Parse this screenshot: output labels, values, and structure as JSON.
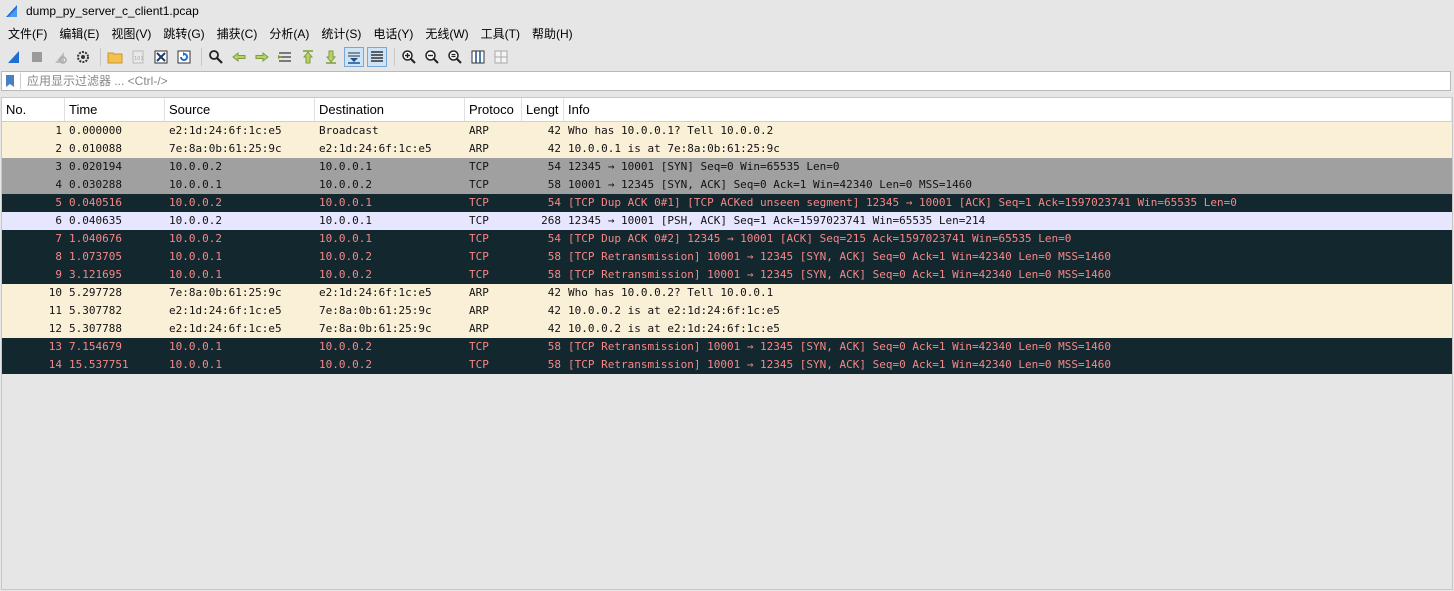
{
  "window": {
    "title": "dump_py_server_c_client1.pcap"
  },
  "menu": [
    "文件(F)",
    "编辑(E)",
    "视图(V)",
    "跳转(G)",
    "捕获(C)",
    "分析(A)",
    "统计(S)",
    "电话(Y)",
    "无线(W)",
    "工具(T)",
    "帮助(H)"
  ],
  "filter": {
    "placeholder": "应用显示过滤器 ... <Ctrl-/>",
    "value": ""
  },
  "columns": {
    "no": "No.",
    "time": "Time",
    "source": "Source",
    "destination": "Destination",
    "protocol": "Protoco",
    "length": "Lengt",
    "info": "Info"
  },
  "colors": {
    "arp_bg": "#faf0d7",
    "tcp_gray_bg": "#a0a0a0",
    "tcp_bad_bg": "#12272e",
    "tcp_bad_fg": "#f78787",
    "tcp_ok_bg": "#e7e6ff",
    "selected_toolbar": "#cde3f7"
  },
  "packets": [
    {
      "no": "1",
      "time": "0.000000",
      "source": "e2:1d:24:6f:1c:e5",
      "destination": "Broadcast",
      "protocol": "ARP",
      "length": "42",
      "info": "Who has 10.0.0.1? Tell 10.0.0.2",
      "style": "arp"
    },
    {
      "no": "2",
      "time": "0.010088",
      "source": "7e:8a:0b:61:25:9c",
      "destination": "e2:1d:24:6f:1c:e5",
      "protocol": "ARP",
      "length": "42",
      "info": "10.0.0.1 is at 7e:8a:0b:61:25:9c",
      "style": "arp"
    },
    {
      "no": "3",
      "time": "0.020194",
      "source": "10.0.0.2",
      "destination": "10.0.0.1",
      "protocol": "TCP",
      "length": "54",
      "info": "12345 → 10001 [SYN] Seq=0 Win=65535 Len=0",
      "style": "tcp-gray"
    },
    {
      "no": "4",
      "time": "0.030288",
      "source": "10.0.0.1",
      "destination": "10.0.0.2",
      "protocol": "TCP",
      "length": "58",
      "info": "10001 → 12345 [SYN, ACK] Seq=0 Ack=1 Win=42340 Len=0 MSS=1460",
      "style": "tcp-gray"
    },
    {
      "no": "5",
      "time": "0.040516",
      "source": "10.0.0.2",
      "destination": "10.0.0.1",
      "protocol": "TCP",
      "length": "54",
      "info": "[TCP Dup ACK 0#1] [TCP ACKed unseen segment] 12345 → 10001 [ACK] Seq=1 Ack=1597023741 Win=65535 Len=0",
      "style": "tcp-bad"
    },
    {
      "no": "6",
      "time": "0.040635",
      "source": "10.0.0.2",
      "destination": "10.0.0.1",
      "protocol": "TCP",
      "length": "268",
      "info": "12345 → 10001 [PSH, ACK] Seq=1 Ack=1597023741 Win=65535 Len=214",
      "style": "tcp-ok"
    },
    {
      "no": "7",
      "time": "1.040676",
      "source": "10.0.0.2",
      "destination": "10.0.0.1",
      "protocol": "TCP",
      "length": "54",
      "info": "[TCP Dup ACK 0#2] 12345 → 10001 [ACK] Seq=215 Ack=1597023741 Win=65535 Len=0",
      "style": "tcp-bad"
    },
    {
      "no": "8",
      "time": "1.073705",
      "source": "10.0.0.1",
      "destination": "10.0.0.2",
      "protocol": "TCP",
      "length": "58",
      "info": "[TCP Retransmission] 10001 → 12345 [SYN, ACK] Seq=0 Ack=1 Win=42340 Len=0 MSS=1460",
      "style": "tcp-bad"
    },
    {
      "no": "9",
      "time": "3.121695",
      "source": "10.0.0.1",
      "destination": "10.0.0.2",
      "protocol": "TCP",
      "length": "58",
      "info": "[TCP Retransmission] 10001 → 12345 [SYN, ACK] Seq=0 Ack=1 Win=42340 Len=0 MSS=1460",
      "style": "tcp-bad"
    },
    {
      "no": "10",
      "time": "5.297728",
      "source": "7e:8a:0b:61:25:9c",
      "destination": "e2:1d:24:6f:1c:e5",
      "protocol": "ARP",
      "length": "42",
      "info": "Who has 10.0.0.2? Tell 10.0.0.1",
      "style": "arp"
    },
    {
      "no": "11",
      "time": "5.307782",
      "source": "e2:1d:24:6f:1c:e5",
      "destination": "7e:8a:0b:61:25:9c",
      "protocol": "ARP",
      "length": "42",
      "info": "10.0.0.2 is at e2:1d:24:6f:1c:e5",
      "style": "arp"
    },
    {
      "no": "12",
      "time": "5.307788",
      "source": "e2:1d:24:6f:1c:e5",
      "destination": "7e:8a:0b:61:25:9c",
      "protocol": "ARP",
      "length": "42",
      "info": "10.0.0.2 is at e2:1d:24:6f:1c:e5",
      "style": "arp"
    },
    {
      "no": "13",
      "time": "7.154679",
      "source": "10.0.0.1",
      "destination": "10.0.0.2",
      "protocol": "TCP",
      "length": "58",
      "info": "[TCP Retransmission] 10001 → 12345 [SYN, ACK] Seq=0 Ack=1 Win=42340 Len=0 MSS=1460",
      "style": "tcp-bad"
    },
    {
      "no": "14",
      "time": "15.537751",
      "source": "10.0.0.1",
      "destination": "10.0.0.2",
      "protocol": "TCP",
      "length": "58",
      "info": "[TCP Retransmission] 10001 → 12345 [SYN, ACK] Seq=0 Ack=1 Win=42340 Len=0 MSS=1460",
      "style": "tcp-bad"
    }
  ],
  "toolbar_icons": [
    "shark-fin-start-icon",
    "stop-icon",
    "restart-icon",
    "options-gear-icon",
    "open-folder-icon",
    "save-file-icon",
    "close-file-icon",
    "reload-icon",
    "find-icon",
    "back-arrow-icon",
    "forward-arrow-icon",
    "goto-packet-icon",
    "first-packet-icon",
    "last-packet-icon",
    "autoscroll-icon",
    "colorize-icon",
    "zoom-in-icon",
    "zoom-out-icon",
    "zoom-reset-icon",
    "resize-columns-icon",
    "layout-icon"
  ]
}
